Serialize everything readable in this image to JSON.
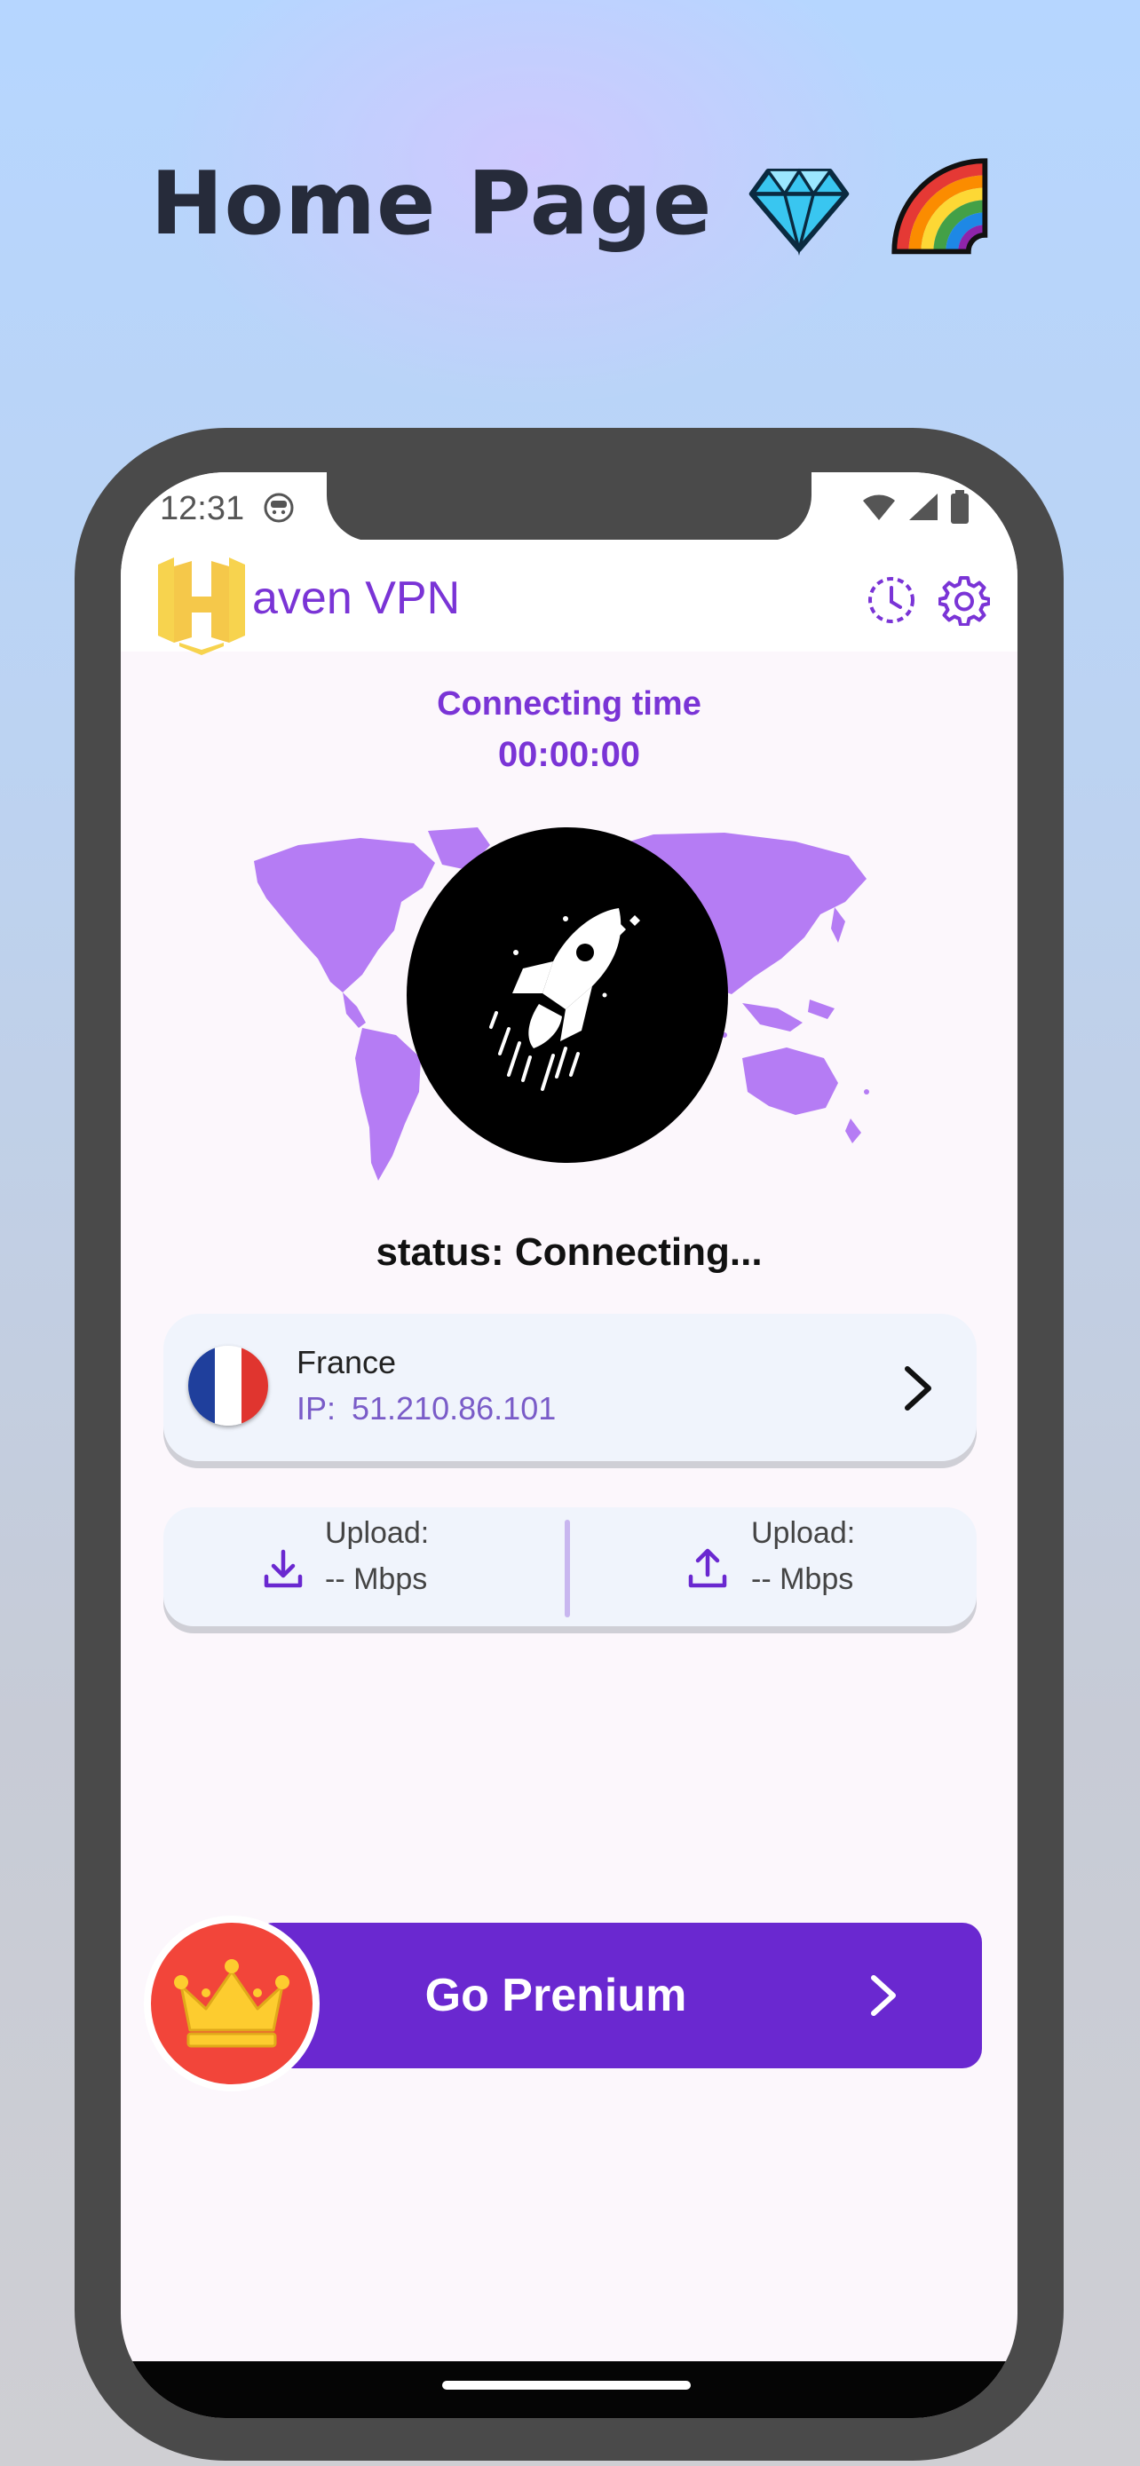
{
  "headline": {
    "title": "Home Page",
    "emojis": [
      "gem-icon",
      "rainbow-icon"
    ]
  },
  "status_bar": {
    "time": "12:31",
    "icons": [
      "bot-face-icon",
      "wifi-icon",
      "signal-icon",
      "battery-icon"
    ]
  },
  "header": {
    "logo_icon": "haven-shield-logo-icon",
    "brand": "aven VPN",
    "actions": [
      "history-icon",
      "settings-gear-icon"
    ]
  },
  "connection": {
    "time_label": "Connecting time",
    "time_value": "00:00:00",
    "status": "status: Connecting..."
  },
  "server": {
    "country": "France",
    "ip_label": "IP:",
    "ip_value": "51.210.86.101",
    "flag_colors": [
      "#1f3f9c",
      "#ffffff",
      "#e0352f"
    ]
  },
  "speeds": {
    "left": {
      "label": "Upload:",
      "value": "-- Mbps",
      "icon": "download-icon"
    },
    "right": {
      "label": "Upload:",
      "value": "-- Mbps",
      "icon": "upload-icon"
    }
  },
  "premium": {
    "label": "Go Prenium",
    "icon": "crown-icon"
  },
  "colors": {
    "accent": "#6a28d0",
    "accent_text": "#7a34d6",
    "map": "#b57cf4",
    "crown_badge": "#f2453a",
    "logo": "#f7d34e"
  }
}
